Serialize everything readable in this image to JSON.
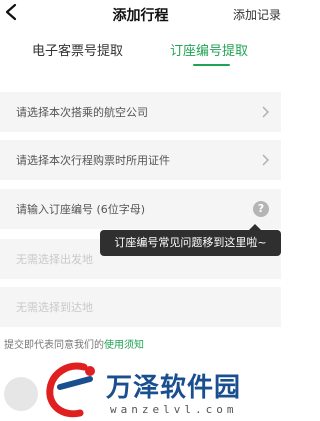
{
  "header": {
    "title": "添加行程",
    "right_label": "添加记录",
    "back_icon": "chevron-left-icon"
  },
  "tabs": [
    {
      "label": "电子客票号提取",
      "active": false
    },
    {
      "label": "订座编号提取",
      "active": true
    }
  ],
  "form": {
    "airline_placeholder": "请选择本次搭乘的航空公司",
    "id_placeholder": "请选择本次行程购票时所用证件",
    "booking_placeholder": "请输入订座编号 (6位字母)",
    "departure_placeholder": "无需选择出发地",
    "arrival_placeholder": "无需选择到达地"
  },
  "tooltip": {
    "text": "订座编号常见问题移到这里啦~"
  },
  "agreement": {
    "prefix": "提交即代表同意我们的",
    "link": "使用须知"
  },
  "watermark": {
    "name": "万泽软件园",
    "url": "wanzelvl.com"
  },
  "colors": {
    "accent": "#21a355",
    "field_bg": "#f5f5f5",
    "tooltip_bg": "#2f2f2f"
  }
}
